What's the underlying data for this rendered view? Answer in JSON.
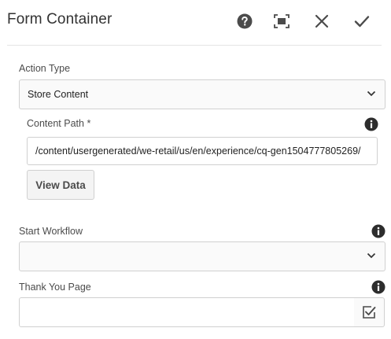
{
  "header": {
    "title": "Form Container",
    "icons": {
      "help": "help-circle-icon",
      "fullscreen": "fullscreen-icon",
      "close": "close-icon",
      "done": "checkmark-icon"
    }
  },
  "form": {
    "action_type": {
      "label": "Action Type",
      "value": "Store Content"
    },
    "content_path": {
      "label": "Content Path *",
      "value": "/content/usergenerated/we-retail/us/en/experience/cq-gen1504777805269/"
    },
    "view_data_label": "View Data",
    "start_workflow": {
      "label": "Start Workflow",
      "value": ""
    },
    "thank_you_page": {
      "label": "Thank You Page",
      "value": ""
    }
  },
  "colors": {
    "icon_dark": "#4b4b4b",
    "border": "#d0d0d0",
    "info_icon": "#2d2d2d"
  }
}
